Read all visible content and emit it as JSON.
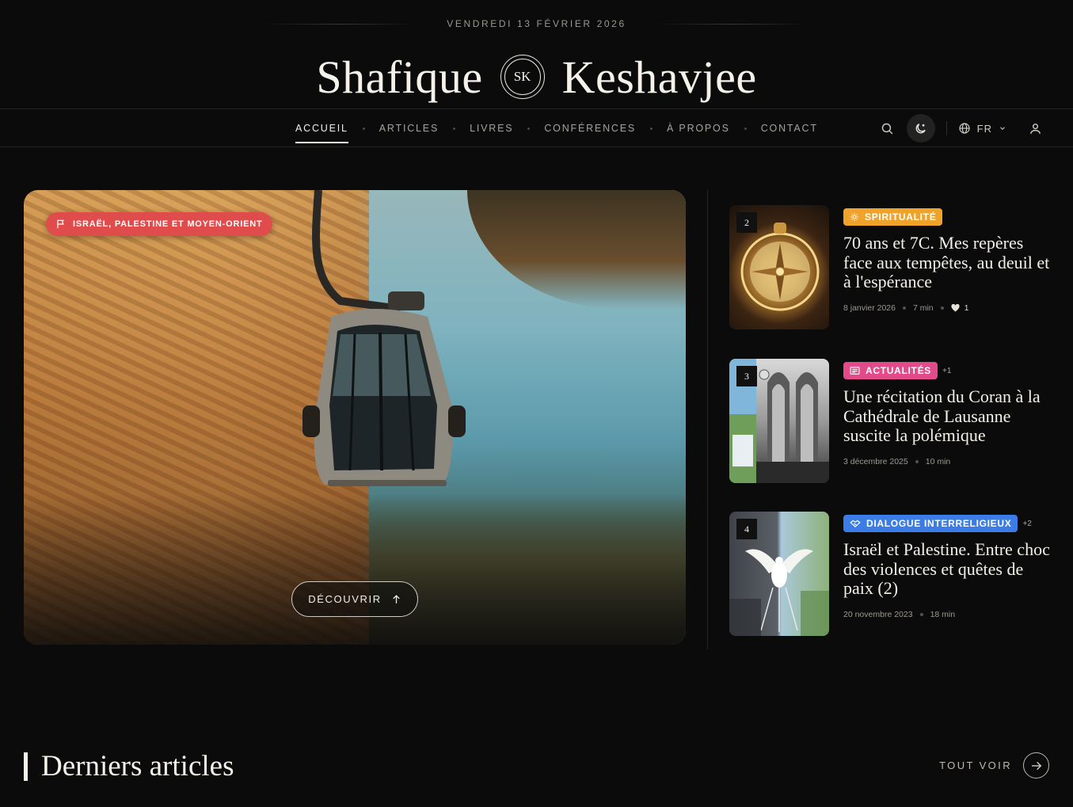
{
  "date": "VENDREDI 13 FÉVRIER 2026",
  "brand": {
    "first": "Shafique",
    "monogram": "SK",
    "last": "Keshavjee"
  },
  "nav": {
    "items": [
      {
        "label": "ACCUEIL",
        "active": true
      },
      {
        "label": "ARTICLES"
      },
      {
        "label": "LIVRES"
      },
      {
        "label": "CONFÉRENCES"
      },
      {
        "label": "À PROPOS"
      },
      {
        "label": "CONTACT"
      }
    ],
    "language": "FR",
    "icons": [
      "search-icon",
      "theme-toggle-icon",
      "globe-icon",
      "chevron-down-icon",
      "user-icon"
    ]
  },
  "hero": {
    "category": "ISRAËL, PALESTINE ET MOYEN-ORIENT",
    "category_color": "#e04b4b",
    "cta": "DÉCOUVRIR"
  },
  "side_articles": [
    {
      "number": "2",
      "tag": "SPIRITUALITÉ",
      "tag_color": "#f0a32a",
      "tag_icon": "sun-icon",
      "extra": "",
      "title": "70 ans et 7C. Mes repères face aux tempêtes, au deuil et à l'espérance",
      "date": "8 janvier 2026",
      "read_time": "7 min",
      "likes": "1"
    },
    {
      "number": "3",
      "tag": "ACTUALITÉS",
      "tag_color": "#e24a8a",
      "tag_icon": "newspaper-icon",
      "extra": "+1",
      "title": "Une récitation du Coran à la Cathédrale de Lausanne suscite la polémique",
      "date": "3 décembre 2025",
      "read_time": "10 min"
    },
    {
      "number": "4",
      "tag": "DIALOGUE INTERRELIGIEUX",
      "tag_color": "#3b7ce6",
      "tag_icon": "handshake-icon",
      "extra": "+2",
      "title": "Israël et Palestine. Entre choc des violences et quêtes de paix (2)",
      "date": "20 novembre 2023",
      "read_time": "18 min"
    }
  ],
  "latest": {
    "title": "Derniers articles",
    "see_all": "TOUT VOIR"
  }
}
